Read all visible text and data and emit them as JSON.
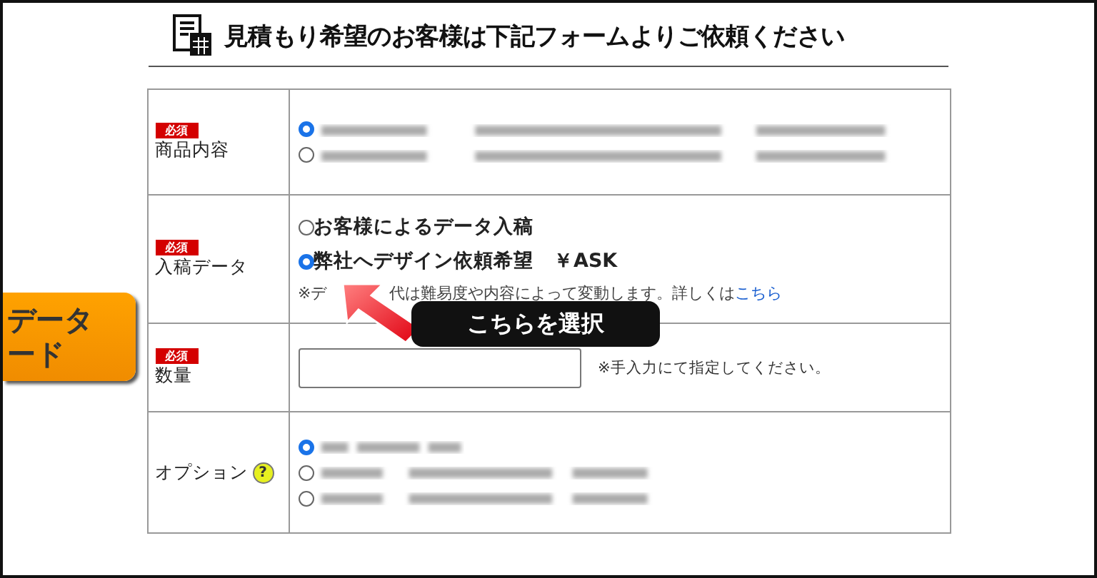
{
  "header": {
    "title": "見積もり希望のお客様は下記フォームよりご依頼ください"
  },
  "side_button": {
    "lines": [
      "データ",
      "ード"
    ]
  },
  "form": {
    "rows": [
      {
        "kind": "choices",
        "required": "必須",
        "label": "商品内容",
        "options": [
          {
            "selected": true
          },
          {
            "selected": false
          }
        ]
      },
      {
        "kind": "choices",
        "required": "必須",
        "label": "入稿データ",
        "options": [
          {
            "label": "お客様によるデータ入稿",
            "selected": false
          },
          {
            "label": "弊社へデザイン依頼希望　￥ASK",
            "selected": true
          }
        ],
        "note": {
          "parts": [
            "※デ",
            "代は難易度や内容によって変動します。詳しくは"
          ],
          "link": "こちら"
        }
      },
      {
        "kind": "quantity",
        "required": "必須",
        "label": "数量",
        "hint": "※手入力にて指定してください。"
      },
      {
        "kind": "choices",
        "label": "オプション",
        "help": "?",
        "options": [
          {
            "selected": true
          },
          {
            "selected": false
          },
          {
            "selected": false
          }
        ]
      }
    ]
  },
  "callout": {
    "text": "こちらを選択"
  }
}
